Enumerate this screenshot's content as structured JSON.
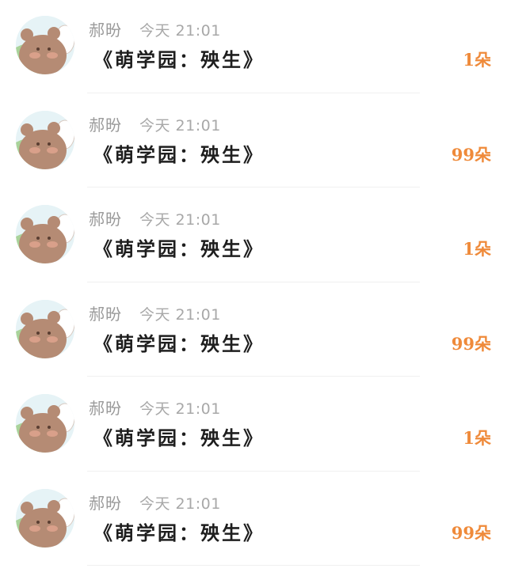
{
  "colors": {
    "accent": "#ef8a3a",
    "username": "#9a9a9a",
    "title": "#1e1e1e"
  },
  "messages": [
    {
      "avatar_icon": "bear-avatar-icon",
      "username": "郝昐",
      "time": "今天 21:01",
      "title": "《萌学园：殃生》",
      "gift": "1朵"
    },
    {
      "avatar_icon": "bear-avatar-icon",
      "username": "郝昐",
      "time": "今天 21:01",
      "title": "《萌学园：殃生》",
      "gift": "99朵"
    },
    {
      "avatar_icon": "bear-avatar-icon",
      "username": "郝昐",
      "time": "今天 21:01",
      "title": "《萌学园：殃生》",
      "gift": "1朵"
    },
    {
      "avatar_icon": "bear-avatar-icon",
      "username": "郝昐",
      "time": "今天 21:01",
      "title": "《萌学园：殃生》",
      "gift": "99朵"
    },
    {
      "avatar_icon": "bear-avatar-icon",
      "username": "郝昐",
      "time": "今天 21:01",
      "title": "《萌学园：殃生》",
      "gift": "1朵"
    },
    {
      "avatar_icon": "bear-avatar-icon",
      "username": "郝昐",
      "time": "今天 21:01",
      "title": "《萌学园：殃生》",
      "gift": "99朵"
    }
  ]
}
